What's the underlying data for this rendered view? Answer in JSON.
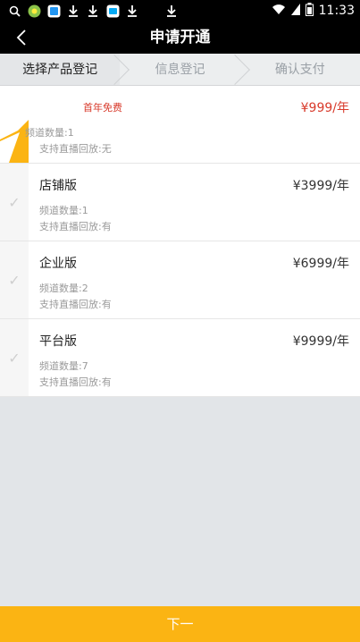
{
  "status_bar": {
    "time": "11:33",
    "left_icons": [
      "search-icon",
      "app-icon",
      "gallery-icon",
      "download-icon",
      "download-icon",
      "browser-icon",
      "download-icon",
      "download-icon"
    ],
    "right_icons": [
      "wifi-icon",
      "signal-icon",
      "battery-icon"
    ]
  },
  "header": {
    "title": "申请开通"
  },
  "steps": [
    {
      "label": "选择产品登记",
      "active": true
    },
    {
      "label": "信息登记",
      "active": false
    },
    {
      "label": "确认支付",
      "active": false
    }
  ],
  "plans": [
    {
      "name": "",
      "promo": "首年免费",
      "price": "¥999/年",
      "channels": "频道数量:1",
      "playback": "支持直播回放:无",
      "selected": true
    },
    {
      "name": "店铺版",
      "price": "¥3999/年",
      "channels": "频道数量:1",
      "playback": "支持直播回放:有",
      "selected": false
    },
    {
      "name": "企业版",
      "price": "¥6999/年",
      "channels": "频道数量:2",
      "playback": "支持直播回放:有",
      "selected": false
    },
    {
      "name": "平台版",
      "price": "¥9999/年",
      "channels": "频道数量:7",
      "playback": "支持直播回放:有",
      "selected": false
    }
  ],
  "footer": {
    "next_label": "下一"
  },
  "colors": {
    "accent": "#fbb413",
    "promo": "#d83a2b"
  }
}
